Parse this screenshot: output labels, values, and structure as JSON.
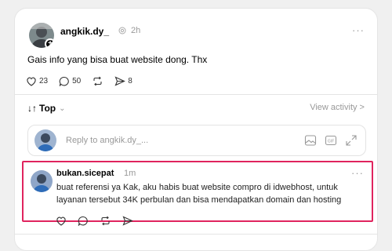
{
  "post": {
    "username": "angkik.dy_",
    "time": "2h",
    "text": "Gais info yang bisa buat website dong. Thx",
    "likes": "23",
    "comments": "50",
    "shares": "8"
  },
  "sort": {
    "label": "Top",
    "view_activity": "View activity >"
  },
  "reply": {
    "placeholder": "Reply to angkik.dy_..."
  },
  "comment": {
    "username": "bukan.sicepat",
    "time": "1m",
    "text": "buat referensi ya Kak, aku habis buat website compro di idwebhost, untuk layanan tersebut 34K perbulan dan bisa mendapatkan domain dan hosting"
  }
}
